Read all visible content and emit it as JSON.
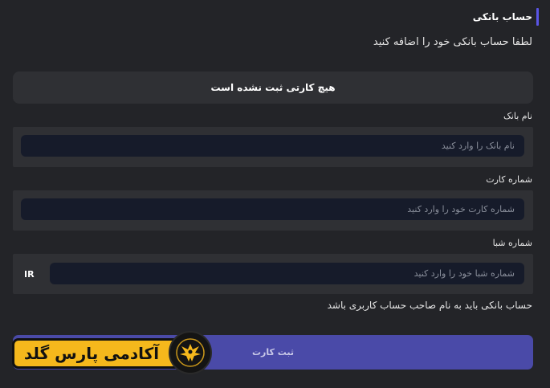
{
  "section": {
    "title": "حساب بانکی",
    "subtitle": "لطفا حساب بانکی خود را اضافه کنید"
  },
  "empty_state": {
    "text": "هیچ کارتی ثبت نشده است"
  },
  "fields": {
    "bank_name": {
      "label": "نام بانک",
      "placeholder": "نام بانک را وارد کنید",
      "value": ""
    },
    "card_number": {
      "label": "شماره کارت",
      "placeholder": "شماره کارت خود را وارد کنید",
      "value": ""
    },
    "sheba": {
      "label": "شماره شبا",
      "prefix": "IR",
      "placeholder": "شماره شبا خود را وارد کنید",
      "value": ""
    }
  },
  "note": "حساب بانکی باید به نام صاحب حساب کاربری باشد",
  "submit": {
    "label": "ثبت کارت"
  },
  "logo": {
    "text": "آکادمی پارس گلد",
    "emblem": "phoenix-icon"
  },
  "colors": {
    "background": "#232428",
    "card": "#2f3034",
    "input": "#161b2a",
    "accent": "#5a55e6",
    "button": "#4a4aa8",
    "logo_gold": "#f5b81c"
  }
}
